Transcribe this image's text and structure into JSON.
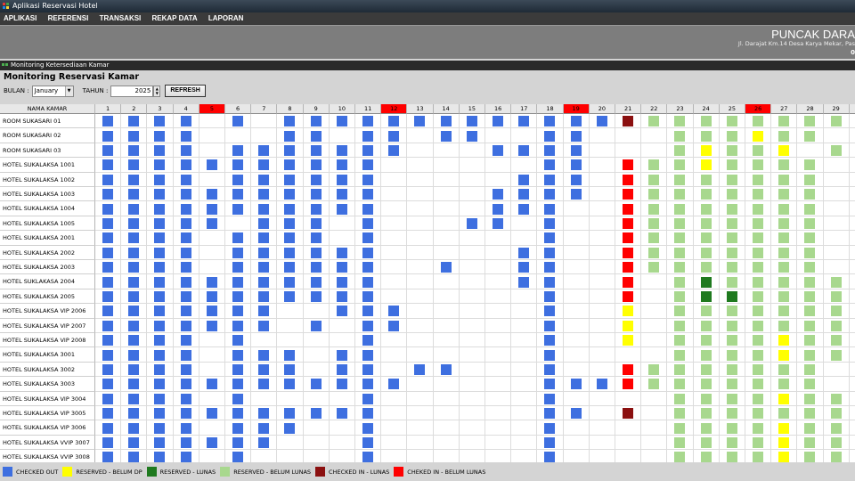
{
  "window": {
    "title": "Aplikasi Reservasi Hotel"
  },
  "menu": {
    "items": [
      "APLIKASI",
      "REFERENSI",
      "TRANSAKSI",
      "REKAP DATA",
      "LAPORAN"
    ]
  },
  "banner": {
    "hotel_name": "PUNCAK DARA",
    "address": "Jl. Darajat Km.14 Desa Karya Mekar, Pas",
    "address2": "0"
  },
  "inner_window": {
    "title": "Monitoring Ketersediaan Kamar"
  },
  "page": {
    "title": "Monitoring Reservasi Kamar",
    "bulan_label": "BULAN :",
    "bulan_value": "January",
    "tahun_label": "TAHUN :",
    "tahun_value": "2025",
    "refresh_label": "REFRESH"
  },
  "table": {
    "name_header": "NAMA KAMAR",
    "days": [
      "1",
      "2",
      "3",
      "4",
      "5",
      "6",
      "7",
      "8",
      "9",
      "10",
      "11",
      "12",
      "13",
      "14",
      "15",
      "16",
      "17",
      "18",
      "19",
      "20",
      "21",
      "22",
      "23",
      "24",
      "25",
      "26",
      "27",
      "28",
      "29",
      "3"
    ],
    "highlight_days": [
      "5",
      "12",
      "19",
      "26"
    ],
    "status_colors": {
      "B": "#3e6fe0",
      "Y": "#ffff00",
      "G": "#1f7a1f",
      "L": "#a8d88e",
      "D": "#8b1010",
      "R": "#ff0000"
    },
    "rooms": [
      {
        "name": "ROOM SUKASARI 01",
        "status": "BBBB.B.BBBBBBBBBBBBBDLLLLLLLL"
      },
      {
        "name": "ROOM SUKASARI 02",
        "status": "BBBB...BB.BB.BB..BB...LLLYLL."
      },
      {
        "name": "ROOM SUKASARI 03",
        "status": "BBBB.BBBBBBB...BBBB...LYLLY.L"
      },
      {
        "name": "HOTEL SUKALAKSA 1001",
        "status": "BBBBBBBBBBB......BB.RLLYLLLL."
      },
      {
        "name": "HOTEL SUKALAKSA 1002",
        "status": "BBBB.BBBBBB.....BBB.RLLLLLLL."
      },
      {
        "name": "HOTEL SUKALAKSA 1003",
        "status": "BBBBBBBBBBB....BBBB.RLLLLLLL."
      },
      {
        "name": "HOTEL SUKALAKSA 1004",
        "status": "BBBBBBBBBBB....BBB..RLLLLLLL."
      },
      {
        "name": "HOTEL SUKALAKSA 1005",
        "status": "BBBBB.BBB.B...BB.B..RLLLLLLL."
      },
      {
        "name": "HOTEL SUKALAKSA 2001",
        "status": "BBBB.BBBB.B......B..RLLLLLLL."
      },
      {
        "name": "HOTEL SUKALAKSA 2002",
        "status": "BBBB.BBBBBB.....BB..RLLLLLLL."
      },
      {
        "name": "HOTEL SUKALAKSA 2003",
        "status": "BBBB.BBBBBB..B..BB..RLLLLLLL."
      },
      {
        "name": "HOTEL SUKLAKASA 2004",
        "status": "BBBBBBBBBBB.....BB..R.LGLLLLL"
      },
      {
        "name": "HOTEL SUKALAKSA 2005",
        "status": "BBBBBBBBBBB......B..R.LGGLLLL"
      },
      {
        "name": "HOTEL SUKALAKSA VIP 2006",
        "status": "BBBBBBB..BBB.....B..Y.LLLLLLL"
      },
      {
        "name": "HOTEL SUKALAKSA VIP 2007",
        "status": "BBBBBBB.B.BB.....B..Y.LLLLLLL"
      },
      {
        "name": "HOTEL SUKALAKSA VIP 2008",
        "status": "BBBB.B....B......B..Y.LLLLYLL"
      },
      {
        "name": "HOTEL SUKALAKSA 3001",
        "status": "BBBB.BBB.BB......B....LLLLYLL"
      },
      {
        "name": "HOTEL SUKALAKSA 3002",
        "status": "BBBB.BBB.BB.BB...B..RLLLLLLL."
      },
      {
        "name": "HOTEL SUKALAKSA 3003",
        "status": "BBBBBBBBBBBB.....BBBRLLLLLLL."
      },
      {
        "name": "HOTEL SUKALAKSA VIP 3004",
        "status": "BBBB.B....B......B....LLLLYLL"
      },
      {
        "name": "HOTEL SUKALAKSA VIP 3005",
        "status": "BBBBBBBBBBB......BB.D.LLLLLLL"
      },
      {
        "name": "HOTEL SUKALAKSA VIP 3006",
        "status": "BBBB.BBB..B......B....LLLLYLL"
      },
      {
        "name": "HOTEL SUKALAKSA VVIP 3007",
        "status": "BBBBBBB...B......B....LLLLYLL"
      },
      {
        "name": "HOTEL SUKALAKSA VVIP 3008",
        "status": "BBBB.B....B......B....LLLLYLL"
      }
    ]
  },
  "legend": [
    {
      "label": "CHECKED OUT",
      "color": "#3e6fe0"
    },
    {
      "label": "RESERVED - BELUM DP",
      "color": "#ffff00"
    },
    {
      "label": "RESERVED - LUNAS",
      "color": "#1f7a1f"
    },
    {
      "label": "RESERVED - BELUM LUNAS",
      "color": "#a8d88e"
    },
    {
      "label": "CHECKED IN - LUNAS",
      "color": "#8b1010"
    },
    {
      "label": "CHEKED IN - BELUM LUNAS",
      "color": "#ff0000"
    }
  ]
}
